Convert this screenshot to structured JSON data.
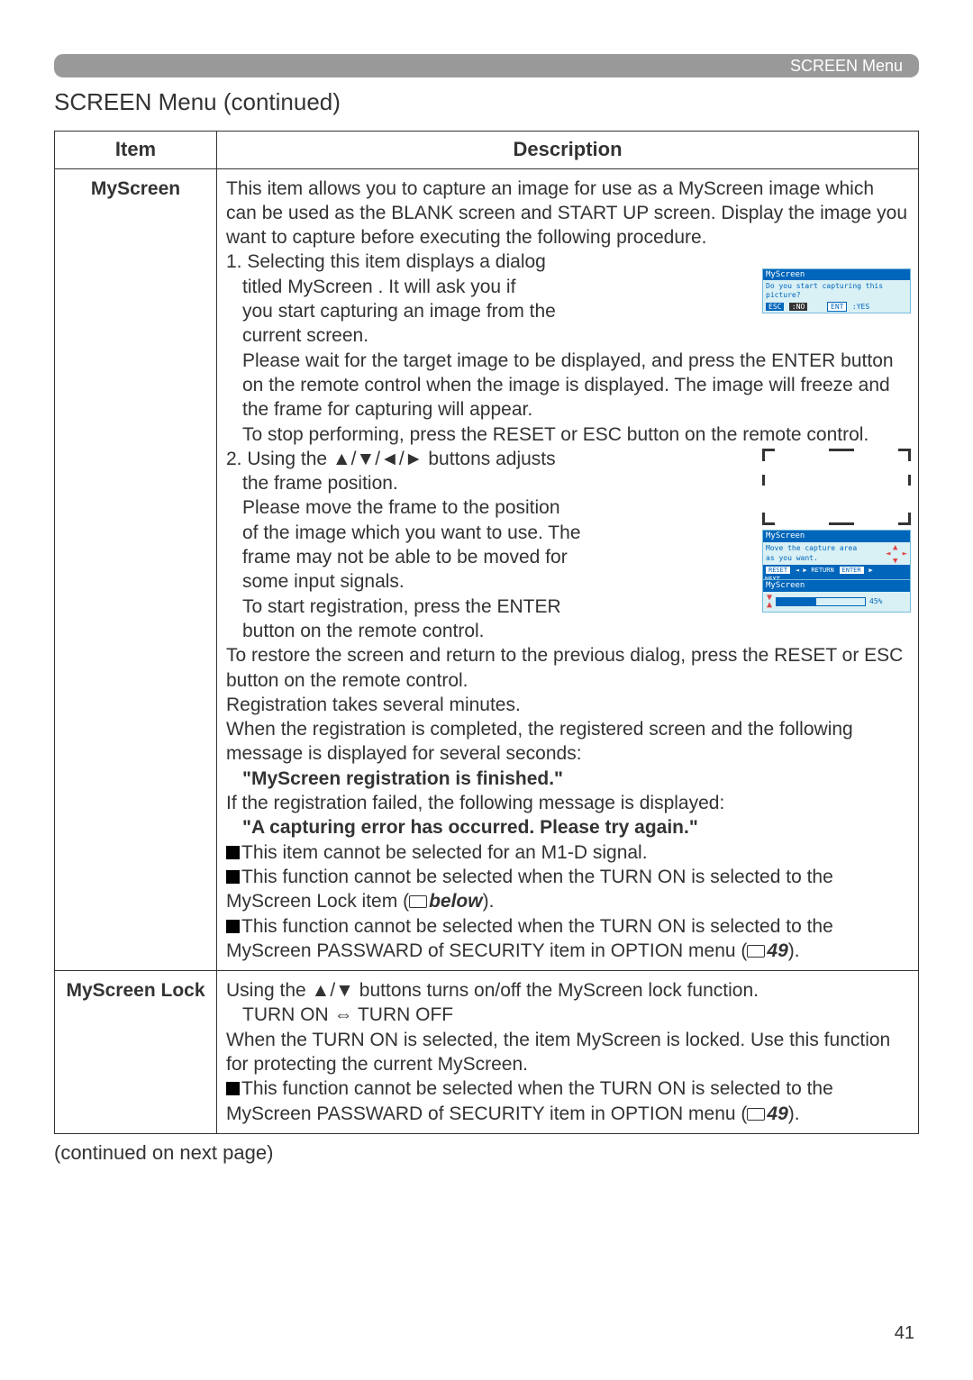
{
  "header": {
    "menu_label": "SCREEN Menu"
  },
  "section_title": "SCREEN Menu (continued)",
  "table": {
    "headers": {
      "item": "Item",
      "desc": "Description"
    },
    "rows": {
      "myscreen": {
        "item": "MyScreen",
        "intro": "This item allows you to capture an image for use as a MyScreen image which can be used as the BLANK screen and START UP screen. Display the image you want to capture before executing the following procedure.",
        "step1_a": "1. Selecting this item displays a dialog",
        "step1_b": "titled  MyScreen . It will ask you if",
        "step1_c": "you start capturing an image from the",
        "step1_d": "current screen.",
        "step1_e": "Please wait for the target image to be displayed, and press the ENTER button on the remote control when the image is displayed. The image will freeze and the frame for capturing will appear.",
        "step1_f": "To stop performing, press the RESET or ESC button on the remote control.",
        "step2_a": "2. Using the ▲/▼/◄/► buttons adjusts",
        "step2_b": "the frame position.",
        "step2_c": "Please move the frame to the position",
        "step2_d": "of the image which you want to use. The",
        "step2_e": "frame may not be able to be moved for",
        "step2_f": "some input signals.",
        "step2_g": "To start registration, press the ENTER",
        "step2_h": "button on the remote control.",
        "restore": "To restore the screen and return to the previous dialog, press the RESET or ESC button on the remote control.",
        "reg_takes": "Registration takes several minutes.",
        "reg_done1": "When the registration is completed, the registered screen and the following message is displayed for several seconds:",
        "reg_done_msg": "\"MyScreen registration is finished.\"",
        "reg_fail1": "If the registration failed, the following message is displayed:",
        "reg_fail_msg": "\"A capturing error has occurred. Please try again.\"",
        "note_m1d": "This item cannot be selected for an M1-D signal.",
        "note_lock1": "This function cannot be selected when the TURN ON is selected to the MyScreen Lock item (",
        "note_lock2": "below",
        "note_lock3": ").",
        "note_pw1": "This function cannot be selected when the TURN ON is selected to the MyScreen PASSWARD of SECURITY item in OPTION menu (",
        "note_pw2": "49",
        "note_pw3": ")."
      },
      "lock": {
        "item": "MyScreen Lock",
        "line1": "Using the ▲/▼ buttons turns on/off the MyScreen lock function.",
        "toggle": "TURN ON  ⇔  TURN OFF",
        "line2": "When the TURN ON is selected, the item MyScreen is locked. Use this function for protecting the current MyScreen.",
        "note_pw1": "This function cannot be selected when the TURN ON is selected to the MyScreen PASSWARD of SECURITY item in OPTION menu (",
        "note_pw2": "49",
        "note_pw3": ")."
      }
    }
  },
  "dialogs": {
    "d1": {
      "title": "MyScreen",
      "body": "Do you start capturing this picture?",
      "esc": "ESC",
      "no": ":NO",
      "ent": "ENT",
      "yes": ":YES"
    },
    "d2": {
      "title": "MyScreen",
      "body1": "Move the capture area",
      "body2": "as you want.",
      "reset": "RESET",
      "ret": "RETURN",
      "enter": "ENTER",
      "next": "NEXT"
    },
    "d3": {
      "title": "MyScreen",
      "pct": "45%"
    }
  },
  "footer_note": "(continued on next page)",
  "page_number": "41"
}
